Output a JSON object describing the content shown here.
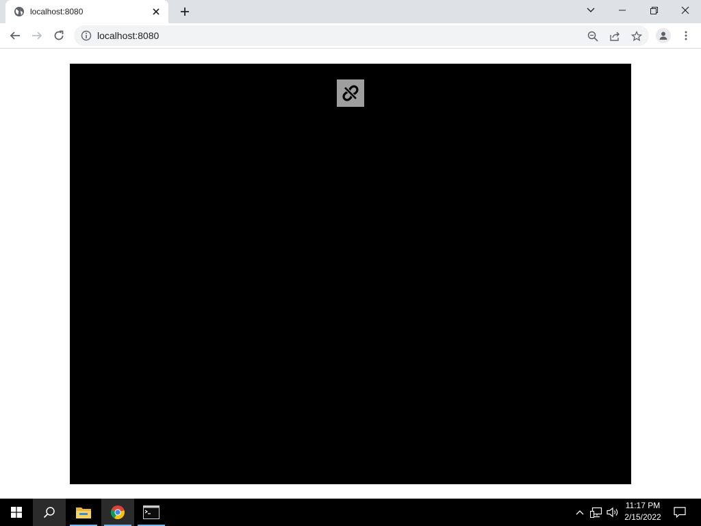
{
  "browser": {
    "tab": {
      "title": "localhost:8080",
      "icon": "globe-icon"
    },
    "new_tab_icon": "plus-icon",
    "window_controls": [
      "tab-search-icon",
      "minimize-icon",
      "restore-icon",
      "close-icon"
    ],
    "toolbar": {
      "back_icon": "arrow-left-icon",
      "forward_icon": "arrow-right-icon",
      "reload_icon": "reload-icon",
      "site_info_icon": "info-icon",
      "url": "localhost:8080",
      "zoom_icon": "zoom-out-icon",
      "share_icon": "share-icon",
      "bookmark_icon": "star-icon",
      "profile_icon": "avatar-icon",
      "menu_icon": "kebab-menu-icon"
    }
  },
  "content": {
    "canvas_color": "#000000",
    "overlay_icon": "broken-link-icon",
    "overlay_color": "#9e9e9e"
  },
  "taskbar": {
    "apps": [
      "windows-start-icon",
      "search-icon",
      "file-explorer-icon",
      "chrome-icon",
      "terminal-icon"
    ],
    "tray_icons": [
      "chevron-up-icon",
      "network-icon",
      "volume-icon"
    ],
    "clock": {
      "time": "11:17 PM",
      "date": "2/15/2022"
    },
    "notification_icon": "notification-icon",
    "accent": "#76b9ed"
  }
}
